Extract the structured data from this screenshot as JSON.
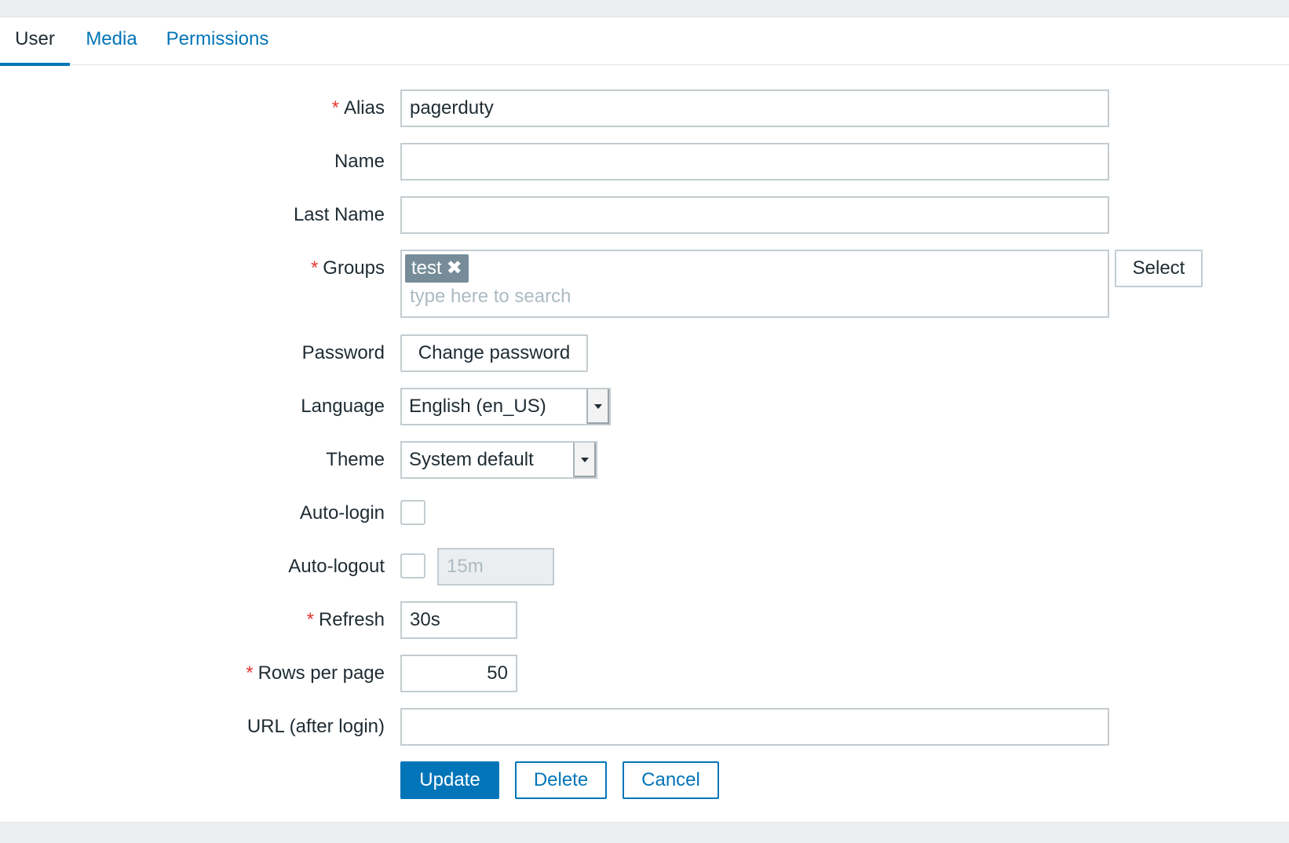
{
  "tabs": [
    {
      "label": "User",
      "active": true
    },
    {
      "label": "Media",
      "active": false
    },
    {
      "label": "Permissions",
      "active": false
    }
  ],
  "form": {
    "required_marker": "*",
    "alias": {
      "label": "Alias",
      "value": "pagerduty",
      "required": true
    },
    "name": {
      "label": "Name",
      "value": ""
    },
    "last_name": {
      "label": "Last Name",
      "value": ""
    },
    "groups": {
      "label": "Groups",
      "required": true,
      "selected": [
        {
          "label": "test"
        }
      ],
      "remove_icon": "close-icon",
      "placeholder": "type here to search",
      "select_button": "Select"
    },
    "password": {
      "label": "Password",
      "button": "Change password"
    },
    "language": {
      "label": "Language",
      "value": "English (en_US)"
    },
    "theme": {
      "label": "Theme",
      "value": "System default"
    },
    "auto_login": {
      "label": "Auto-login",
      "checked": false
    },
    "auto_logout": {
      "label": "Auto-logout",
      "checked": false,
      "value": "15m",
      "disabled": true
    },
    "refresh": {
      "label": "Refresh",
      "value": "30s",
      "required": true
    },
    "rows_per_page": {
      "label": "Rows per page",
      "value": "50",
      "required": true
    },
    "url_after_login": {
      "label": "URL (after login)",
      "value": ""
    }
  },
  "actions": {
    "update": "Update",
    "delete": "Delete",
    "cancel": "Cancel"
  },
  "colors": {
    "accent": "#0275b8",
    "required": "#e33734",
    "chip": "#768d99",
    "border": "#c4ccd1",
    "background": "#ebeef0"
  }
}
